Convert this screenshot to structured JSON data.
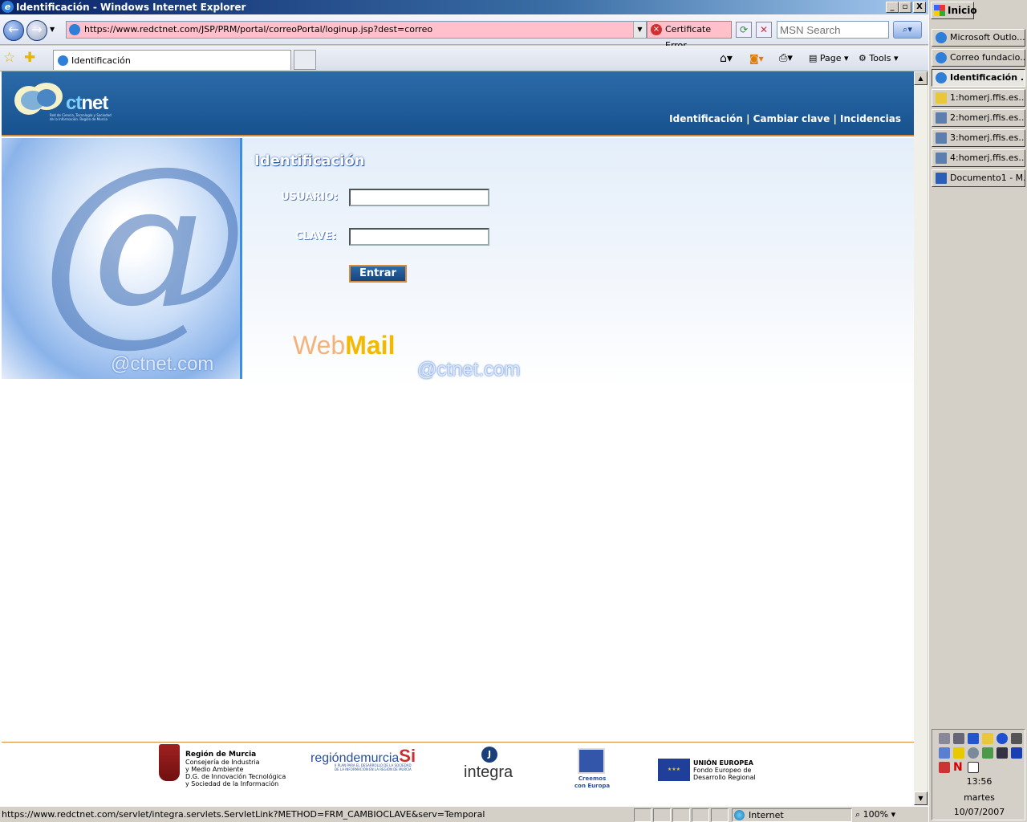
{
  "window": {
    "title": "Identificación - Windows Internet Explorer",
    "btn_min": "_",
    "btn_max": "▫",
    "btn_close": "X"
  },
  "nav": {
    "address": "https://www.redctnet.com/JSP/PRM/portal/correoPortal/loginup.jsp?dest=correo",
    "cert": "Certificate Error",
    "search_placeholder": "MSN Search"
  },
  "tabs": [
    {
      "label": "Identificación"
    }
  ],
  "tools": {
    "page": "Page",
    "tools": "Tools"
  },
  "site": {
    "logo_prefix": "ct",
    "logo_suffix": "net",
    "logo_sub": "Red de Ciencia, Tecnología y Sociedad de la Información. Región de Murcia",
    "nav": [
      "Identificación",
      "Cambiar clave",
      "Incidencias"
    ],
    "sep": "|"
  },
  "login": {
    "title": "Identificación",
    "user_label": "USUARIO:",
    "pass_label": "CLAVE:",
    "submit": "Entrar",
    "webmail_a": "Web",
    "webmail_b": "Mail",
    "domain": "@ctnet.com"
  },
  "footer": {
    "murcia": [
      "Región de Murcia",
      "Consejería de Industria",
      "y Medio Ambiente",
      "D.G. de Innovación Tecnológica",
      "y Sociedad de la Información"
    ],
    "regionmurcia": "regióndemurcia",
    "regionmurcia_si": "Si",
    "regionmurcia_sub": "II PLAN PARA EL DESARROLLO DE LA SOCIEDAD DE LA INFORMACIÓN EN LA REGIÓN DE MURCIA",
    "integra": "integra",
    "europa": [
      "Creemos",
      "con Europa"
    ],
    "ue": [
      "UNIÓN EUROPEA",
      "Fondo Europeo de",
      "Desarrollo Regional"
    ]
  },
  "status": {
    "url": "https://www.redctnet.com/servlet/integra.servlets.ServletLink?METHOD=FRM_CAMBIOCLAVE&serv=Temporal",
    "zone": "Internet",
    "zoom": "100%"
  },
  "taskbar": {
    "start": "Inicio",
    "items": [
      "Microsoft Outlo...",
      "Correo fundacio...",
      "Identificación ...",
      "1:homerj.ffis.es...",
      "2:homerj.ffis.es...",
      "3:homerj.ffis.es...",
      "4:homerj.ffis.es...",
      "Documento1 - M..."
    ],
    "time": "13:56",
    "day": "martes",
    "date": "10/07/2007"
  }
}
